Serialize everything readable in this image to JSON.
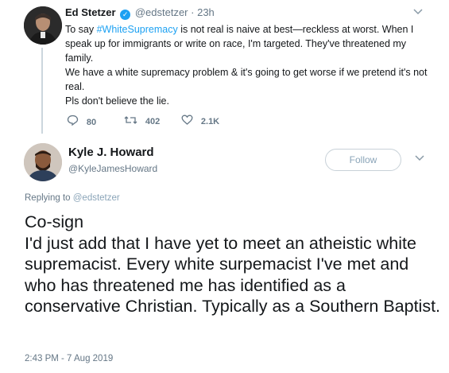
{
  "parent_tweet": {
    "name": "Ed Stetzer",
    "handle": "@edstetzer",
    "separator": "·",
    "time": "23h",
    "body_pre_hashtag": "To say ",
    "hashtag": "#WhiteSupremacy",
    "body_post_hashtag": " is not real is naive at best—reckless at worst. When I speak up for immigrants or write on race, I'm targeted. They've threatened my family.",
    "body_para2": "We have a white supremacy problem & it's going to get worse if we pretend it's not real.",
    "body_para3": "Pls don't believe the lie.",
    "replies": "80",
    "retweets": "402",
    "likes": "2.1K"
  },
  "reply_tweet": {
    "name": "Kyle J. Howard",
    "handle": "@KyleJamesHoward",
    "follow_label": "Follow",
    "replying_label": "Replying to",
    "replying_to": "@edstetzer",
    "body_line1": "Co-sign",
    "body_line2": "I'd just add that I have yet to meet an atheistic white supremacist. Every white surpemacist I've met and who has threatened me has identified as a conservative Christian. Typically as a Southern Baptist.",
    "timestamp": "2:43 PM - 7 Aug 2019"
  },
  "colors": {
    "link": "#1da1f2",
    "muted": "#657786",
    "text": "#14171a",
    "thread_line": "#ccd6dd"
  },
  "icons": [
    "verified-badge-icon",
    "chevron-down-icon",
    "reply-icon",
    "retweet-icon",
    "like-icon"
  ]
}
